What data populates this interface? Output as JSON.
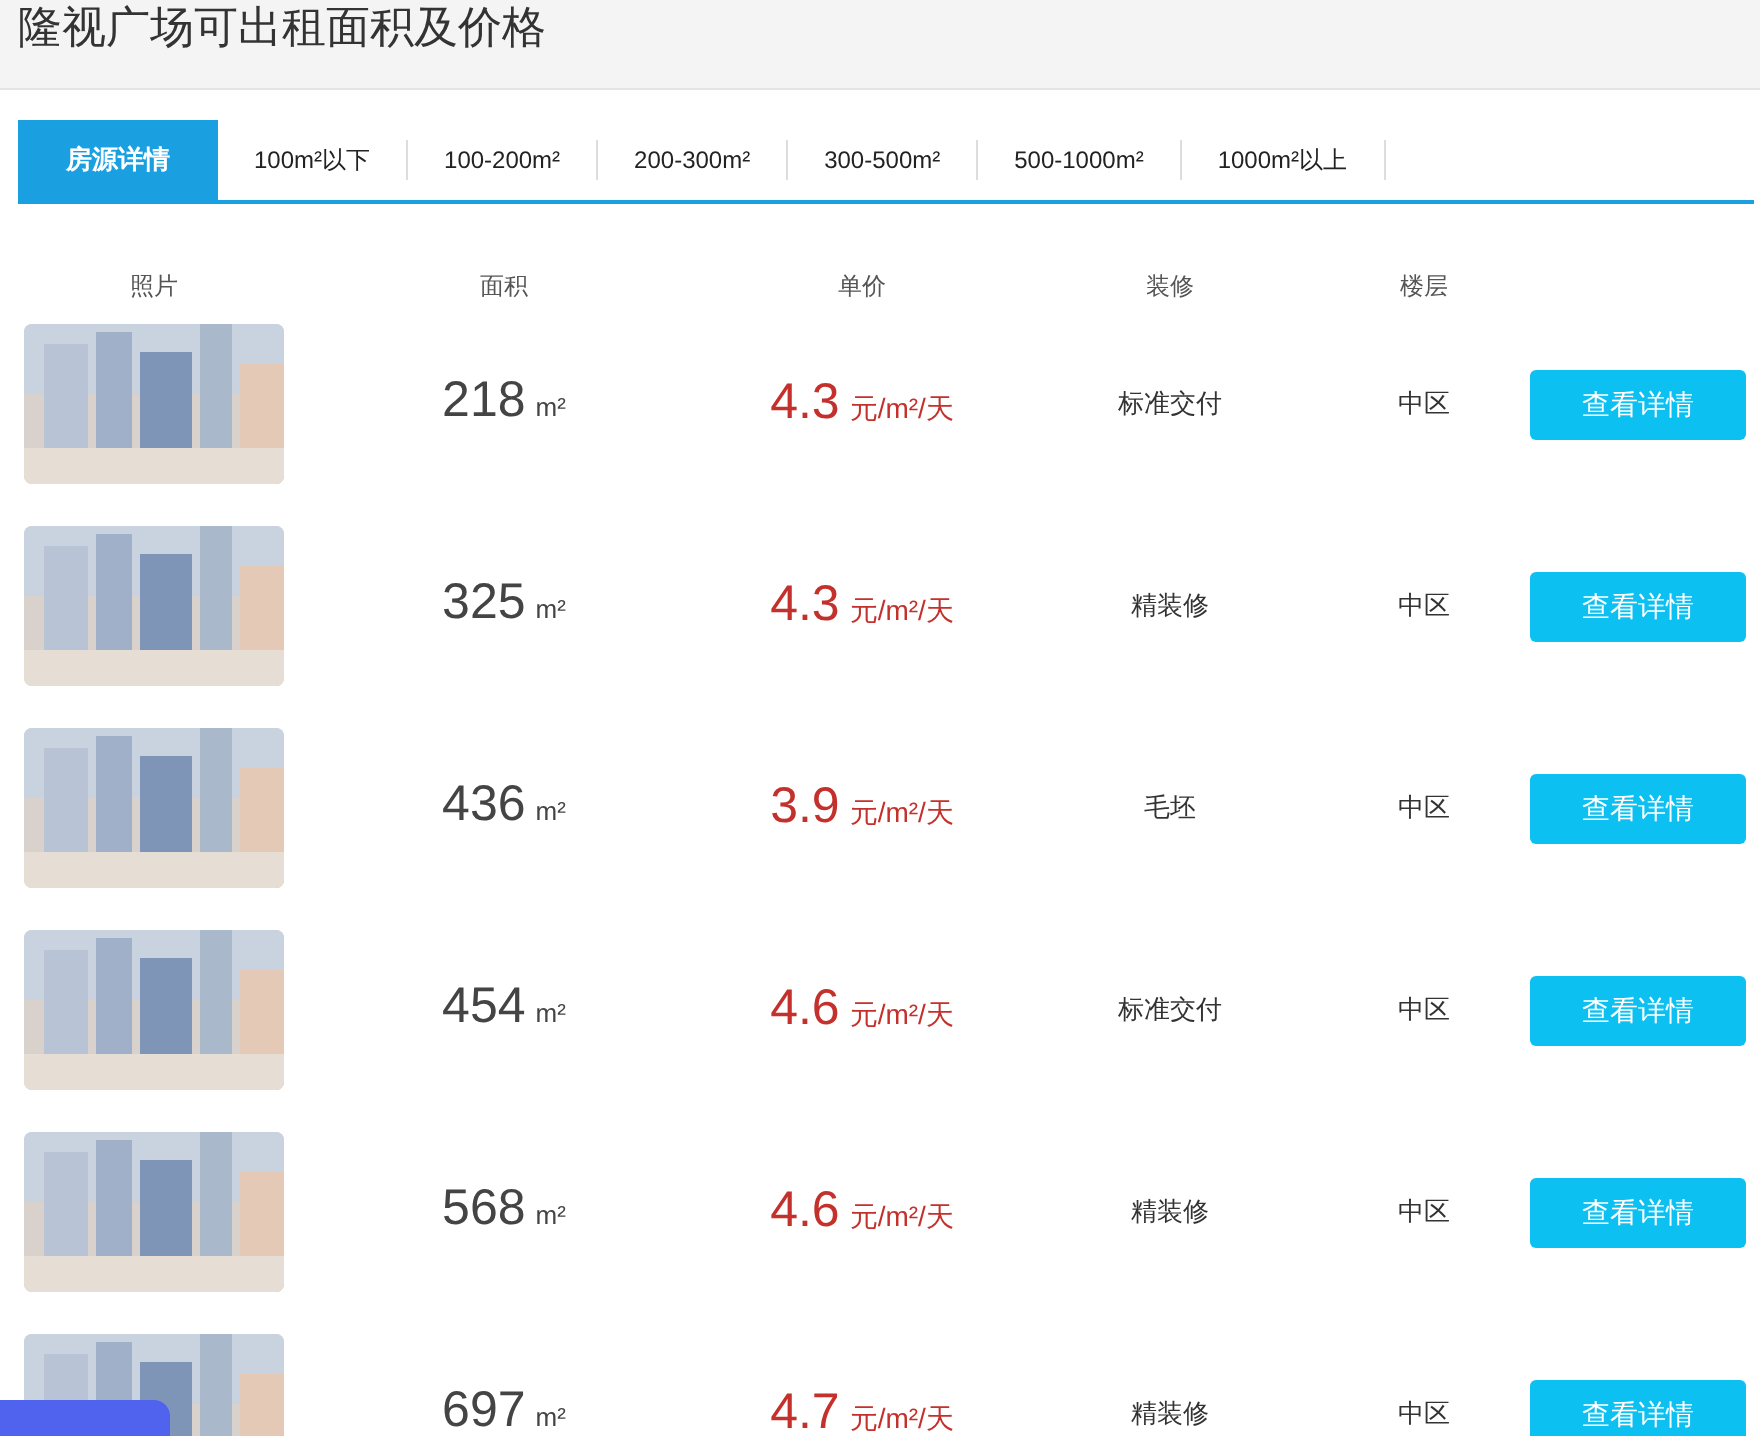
{
  "title": "隆视广场可出租面积及价格",
  "tabs": [
    {
      "label": "房源详情",
      "selected": true
    },
    {
      "label": "100m²以下",
      "selected": false
    },
    {
      "label": "100-200m²",
      "selected": false
    },
    {
      "label": "200-300m²",
      "selected": false
    },
    {
      "label": "300-500m²",
      "selected": false
    },
    {
      "label": "500-1000m²",
      "selected": false
    },
    {
      "label": "1000m²以上",
      "selected": false
    }
  ],
  "table": {
    "columns": [
      "照片",
      "面积",
      "单价",
      "装修",
      "楼层"
    ],
    "rows": [
      {
        "area": "218",
        "area_unit": "m²",
        "price": "4.3",
        "price_unit": "元/m²/天",
        "decoration": "标准交付",
        "floor": "中区",
        "button": "查看详情"
      },
      {
        "area": "325",
        "area_unit": "m²",
        "price": "4.3",
        "price_unit": "元/m²/天",
        "decoration": "精装修",
        "floor": "中区",
        "button": "查看详情"
      },
      {
        "area": "436",
        "area_unit": "m²",
        "price": "3.9",
        "price_unit": "元/m²/天",
        "decoration": "毛坯",
        "floor": "中区",
        "button": "查看详情"
      },
      {
        "area": "454",
        "area_unit": "m²",
        "price": "4.6",
        "price_unit": "元/m²/天",
        "decoration": "标准交付",
        "floor": "中区",
        "button": "查看详情"
      },
      {
        "area": "568",
        "area_unit": "m²",
        "price": "4.6",
        "price_unit": "元/m²/天",
        "decoration": "精装修",
        "floor": "中区",
        "button": "查看详情"
      },
      {
        "area": "697",
        "area_unit": "m²",
        "price": "4.7",
        "price_unit": "元/m²/天",
        "decoration": "精装修",
        "floor": "中区",
        "button": "查看详情"
      }
    ]
  }
}
